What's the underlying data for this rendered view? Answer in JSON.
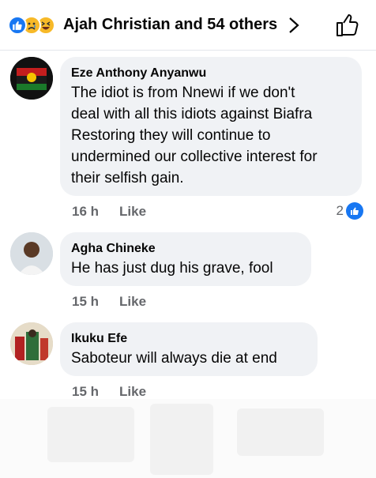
{
  "reactions": {
    "summary": "Ajah Christian and 54 others",
    "icons": [
      "like-icon",
      "sad-icon",
      "haha-icon"
    ]
  },
  "comments": [
    {
      "author": "Eze Anthony Anyanwu",
      "lines": [
        "The idiot is from Nnewi if we don't",
        "deal with all this  idiots against Biafra",
        "Restoring they will continue to",
        "undermined our collective interest for",
        "their selfish gain."
      ],
      "time": "16 h",
      "like_label": "Like",
      "reaction_count": "2"
    },
    {
      "author": "Agha Chineke",
      "lines": [
        "He has just dug his grave, fool"
      ],
      "time": "15 h",
      "like_label": "Like"
    },
    {
      "author": "Ikuku Efe",
      "lines": [
        "Saboteur will always die at end"
      ],
      "time": "15 h",
      "like_label": "Like"
    }
  ],
  "colors": {
    "accent": "#1877f2",
    "bubble": "#f0f2f5",
    "meta": "#65676b"
  }
}
